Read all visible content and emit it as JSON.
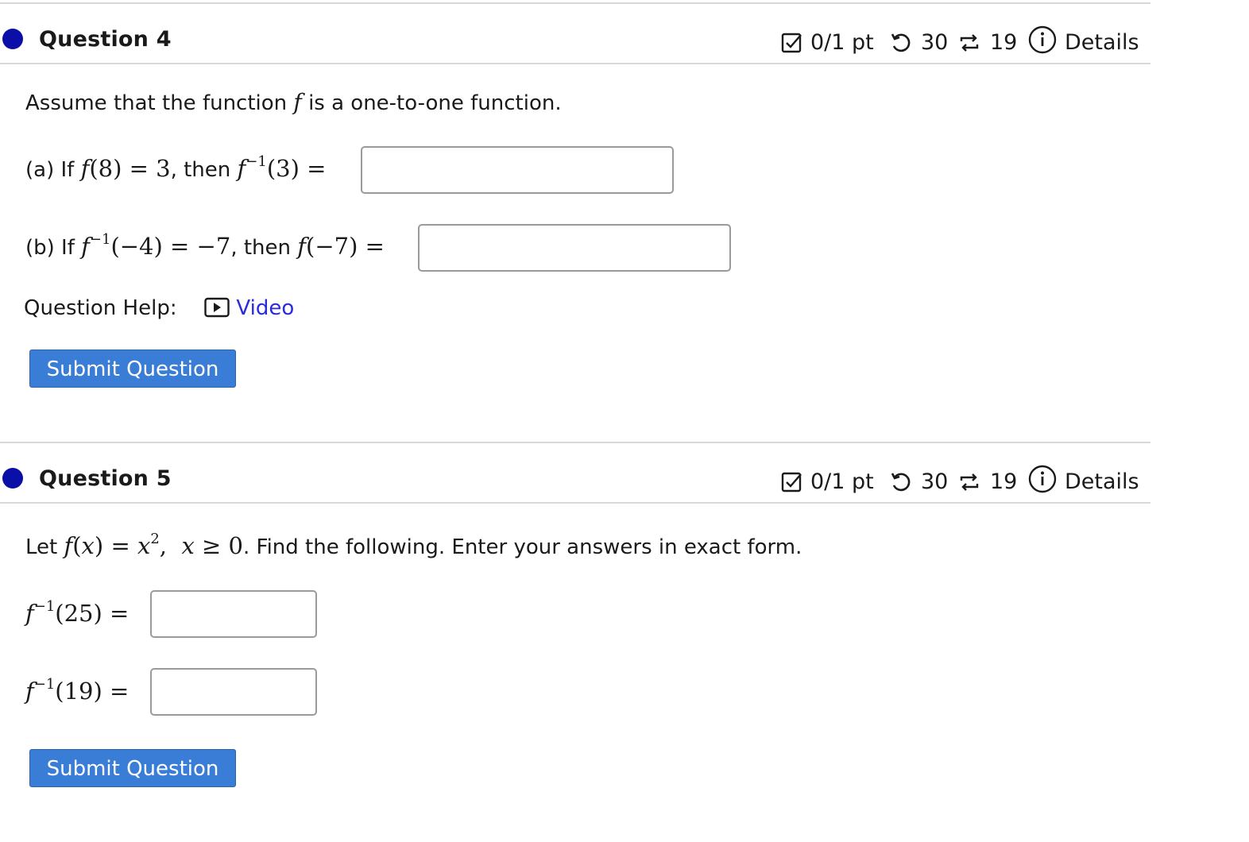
{
  "questions": [
    {
      "title": "Question 4",
      "score": "0/1 pt",
      "retries": "30",
      "attempts": "19",
      "details_label": "Details",
      "prompt_before": "Assume that the function",
      "prompt_var": "f",
      "prompt_after": "is a one-to-one function.",
      "part_a_prefix": "(a) If",
      "part_a_then": ", then",
      "part_b_prefix": "(b) If",
      "part_b_then": ", then",
      "help_label": "Question Help:",
      "video_label": "Video",
      "submit_label": "Submit Question"
    },
    {
      "title": "Question 5",
      "score": "0/1 pt",
      "retries": "30",
      "attempts": "19",
      "details_label": "Details",
      "prompt_let": "Let",
      "prompt_rest": ". Find the following. Enter your answers in exact form.",
      "submit_label": "Submit Question"
    }
  ],
  "icons": {
    "score": "checkbox-icon",
    "retries": "retry-icon",
    "attempts": "attempts-icon",
    "details": "info-icon",
    "video": "play-icon",
    "status": "status-dot-icon"
  },
  "colors": {
    "status_dot": "#0a0fa8",
    "button": "#3a7dd6",
    "link": "#2b2bd9"
  }
}
